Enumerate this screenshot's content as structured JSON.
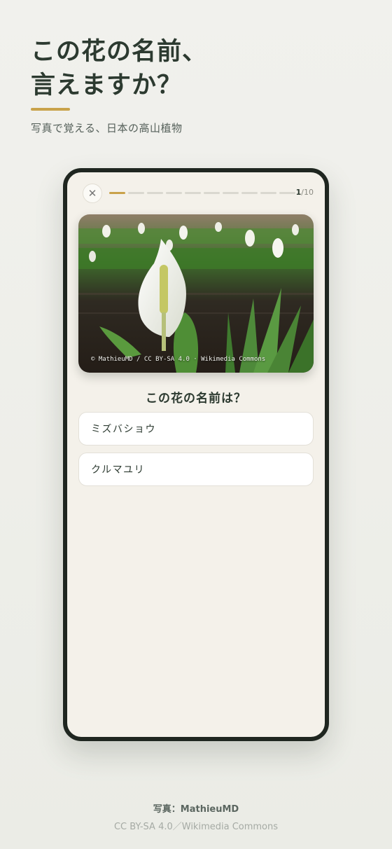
{
  "header": {
    "headline_line1": "この花の名前、",
    "headline_line2": "言えますか？",
    "subtitle": "写真で覚える、日本の高山植物"
  },
  "quiz": {
    "close_icon": "close-icon",
    "progress": {
      "current": 1,
      "total": 10,
      "current_label": "1",
      "total_label": "/10"
    },
    "photo_credit": "© MathieuMD / CC BY-SA 4.0 · Wikimedia Commons",
    "question": "この花の名前は？",
    "options": [
      "ミズバショウ",
      "クルマユリ"
    ]
  },
  "footer": {
    "credit": "写真：MathieuMD",
    "license": "CC BY-SA 4.0／Wikimedia Commons"
  },
  "colors": {
    "accent": "#c9a24a",
    "ink": "#2c3a30",
    "frame": "#1f2620"
  }
}
